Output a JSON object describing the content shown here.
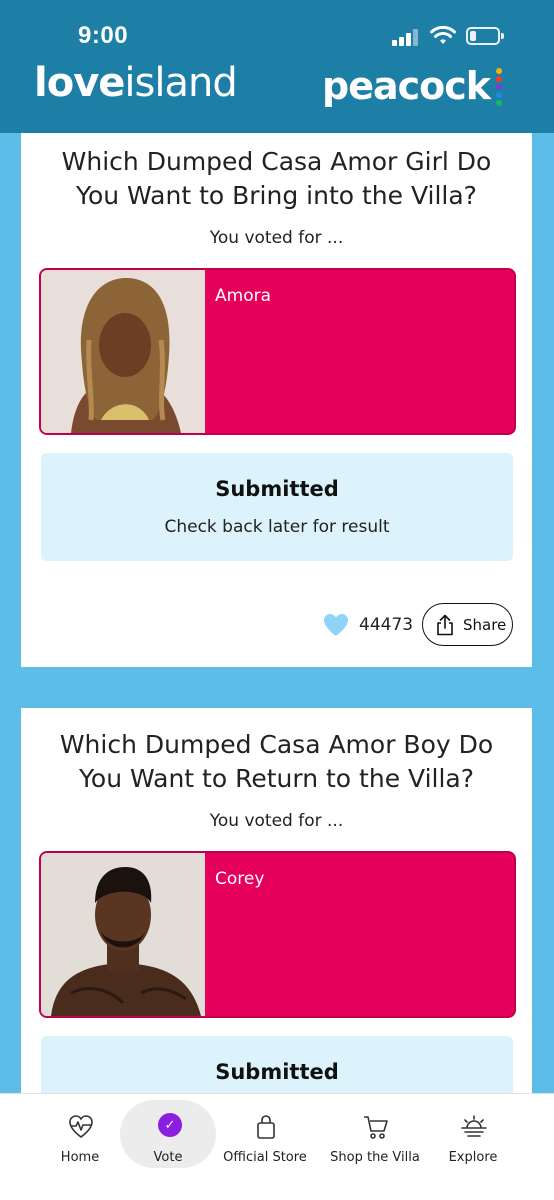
{
  "status_bar": {
    "time": "9:00"
  },
  "header": {
    "brand_love": "love",
    "brand_island": "island",
    "partner": "peacock"
  },
  "colors": {
    "header_bg": "#1e7fa6",
    "page_bg": "#5bbde8",
    "contestant_bg": "#e5005b",
    "submitted_bg": "#ddf3fb",
    "accent_purple": "#8a1fe0"
  },
  "polls": [
    {
      "question": "Which Dumped Casa Amor Girl Do You Want to Bring into the Villa?",
      "voted_label": "You voted for ...",
      "contestant": "Amora",
      "status": "Submitted",
      "status_note": "Check back later for result",
      "likes": "44473",
      "share_label": "Share"
    },
    {
      "question": "Which Dumped Casa Amor Boy Do You Want to Return to the Villa?",
      "voted_label": "You voted for ...",
      "contestant": "Corey",
      "status": "Submitted"
    }
  ],
  "nav": [
    {
      "label": "Home",
      "icon": "heartbeat-icon"
    },
    {
      "label": "Vote",
      "icon": "check-circle-icon",
      "active": true
    },
    {
      "label": "Official Store",
      "icon": "bag-icon"
    },
    {
      "label": "Shop the Villa",
      "icon": "cart-icon"
    },
    {
      "label": "Explore",
      "icon": "sunset-icon"
    }
  ]
}
